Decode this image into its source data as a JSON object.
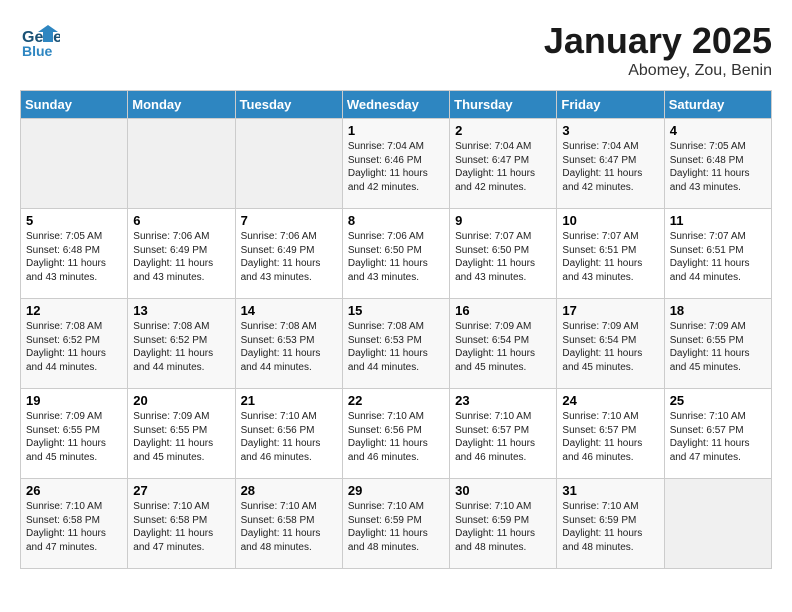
{
  "header": {
    "logo_line1": "General",
    "logo_line2": "Blue",
    "title": "January 2025",
    "subtitle": "Abomey, Zou, Benin"
  },
  "weekdays": [
    "Sunday",
    "Monday",
    "Tuesday",
    "Wednesday",
    "Thursday",
    "Friday",
    "Saturday"
  ],
  "weeks": [
    [
      {
        "day": "",
        "empty": true
      },
      {
        "day": "",
        "empty": true
      },
      {
        "day": "",
        "empty": true
      },
      {
        "day": "1",
        "sunrise": "7:04 AM",
        "sunset": "6:46 PM",
        "daylight": "11 hours and 42 minutes."
      },
      {
        "day": "2",
        "sunrise": "7:04 AM",
        "sunset": "6:47 PM",
        "daylight": "11 hours and 42 minutes."
      },
      {
        "day": "3",
        "sunrise": "7:04 AM",
        "sunset": "6:47 PM",
        "daylight": "11 hours and 42 minutes."
      },
      {
        "day": "4",
        "sunrise": "7:05 AM",
        "sunset": "6:48 PM",
        "daylight": "11 hours and 43 minutes."
      }
    ],
    [
      {
        "day": "5",
        "sunrise": "7:05 AM",
        "sunset": "6:48 PM",
        "daylight": "11 hours and 43 minutes."
      },
      {
        "day": "6",
        "sunrise": "7:06 AM",
        "sunset": "6:49 PM",
        "daylight": "11 hours and 43 minutes."
      },
      {
        "day": "7",
        "sunrise": "7:06 AM",
        "sunset": "6:49 PM",
        "daylight": "11 hours and 43 minutes."
      },
      {
        "day": "8",
        "sunrise": "7:06 AM",
        "sunset": "6:50 PM",
        "daylight": "11 hours and 43 minutes."
      },
      {
        "day": "9",
        "sunrise": "7:07 AM",
        "sunset": "6:50 PM",
        "daylight": "11 hours and 43 minutes."
      },
      {
        "day": "10",
        "sunrise": "7:07 AM",
        "sunset": "6:51 PM",
        "daylight": "11 hours and 43 minutes."
      },
      {
        "day": "11",
        "sunrise": "7:07 AM",
        "sunset": "6:51 PM",
        "daylight": "11 hours and 44 minutes."
      }
    ],
    [
      {
        "day": "12",
        "sunrise": "7:08 AM",
        "sunset": "6:52 PM",
        "daylight": "11 hours and 44 minutes."
      },
      {
        "day": "13",
        "sunrise": "7:08 AM",
        "sunset": "6:52 PM",
        "daylight": "11 hours and 44 minutes."
      },
      {
        "day": "14",
        "sunrise": "7:08 AM",
        "sunset": "6:53 PM",
        "daylight": "11 hours and 44 minutes."
      },
      {
        "day": "15",
        "sunrise": "7:08 AM",
        "sunset": "6:53 PM",
        "daylight": "11 hours and 44 minutes."
      },
      {
        "day": "16",
        "sunrise": "7:09 AM",
        "sunset": "6:54 PM",
        "daylight": "11 hours and 45 minutes."
      },
      {
        "day": "17",
        "sunrise": "7:09 AM",
        "sunset": "6:54 PM",
        "daylight": "11 hours and 45 minutes."
      },
      {
        "day": "18",
        "sunrise": "7:09 AM",
        "sunset": "6:55 PM",
        "daylight": "11 hours and 45 minutes."
      }
    ],
    [
      {
        "day": "19",
        "sunrise": "7:09 AM",
        "sunset": "6:55 PM",
        "daylight": "11 hours and 45 minutes."
      },
      {
        "day": "20",
        "sunrise": "7:09 AM",
        "sunset": "6:55 PM",
        "daylight": "11 hours and 45 minutes."
      },
      {
        "day": "21",
        "sunrise": "7:10 AM",
        "sunset": "6:56 PM",
        "daylight": "11 hours and 46 minutes."
      },
      {
        "day": "22",
        "sunrise": "7:10 AM",
        "sunset": "6:56 PM",
        "daylight": "11 hours and 46 minutes."
      },
      {
        "day": "23",
        "sunrise": "7:10 AM",
        "sunset": "6:57 PM",
        "daylight": "11 hours and 46 minutes."
      },
      {
        "day": "24",
        "sunrise": "7:10 AM",
        "sunset": "6:57 PM",
        "daylight": "11 hours and 46 minutes."
      },
      {
        "day": "25",
        "sunrise": "7:10 AM",
        "sunset": "6:57 PM",
        "daylight": "11 hours and 47 minutes."
      }
    ],
    [
      {
        "day": "26",
        "sunrise": "7:10 AM",
        "sunset": "6:58 PM",
        "daylight": "11 hours and 47 minutes."
      },
      {
        "day": "27",
        "sunrise": "7:10 AM",
        "sunset": "6:58 PM",
        "daylight": "11 hours and 47 minutes."
      },
      {
        "day": "28",
        "sunrise": "7:10 AM",
        "sunset": "6:58 PM",
        "daylight": "11 hours and 48 minutes."
      },
      {
        "day": "29",
        "sunrise": "7:10 AM",
        "sunset": "6:59 PM",
        "daylight": "11 hours and 48 minutes."
      },
      {
        "day": "30",
        "sunrise": "7:10 AM",
        "sunset": "6:59 PM",
        "daylight": "11 hours and 48 minutes."
      },
      {
        "day": "31",
        "sunrise": "7:10 AM",
        "sunset": "6:59 PM",
        "daylight": "11 hours and 48 minutes."
      },
      {
        "day": "",
        "empty": true
      }
    ]
  ]
}
